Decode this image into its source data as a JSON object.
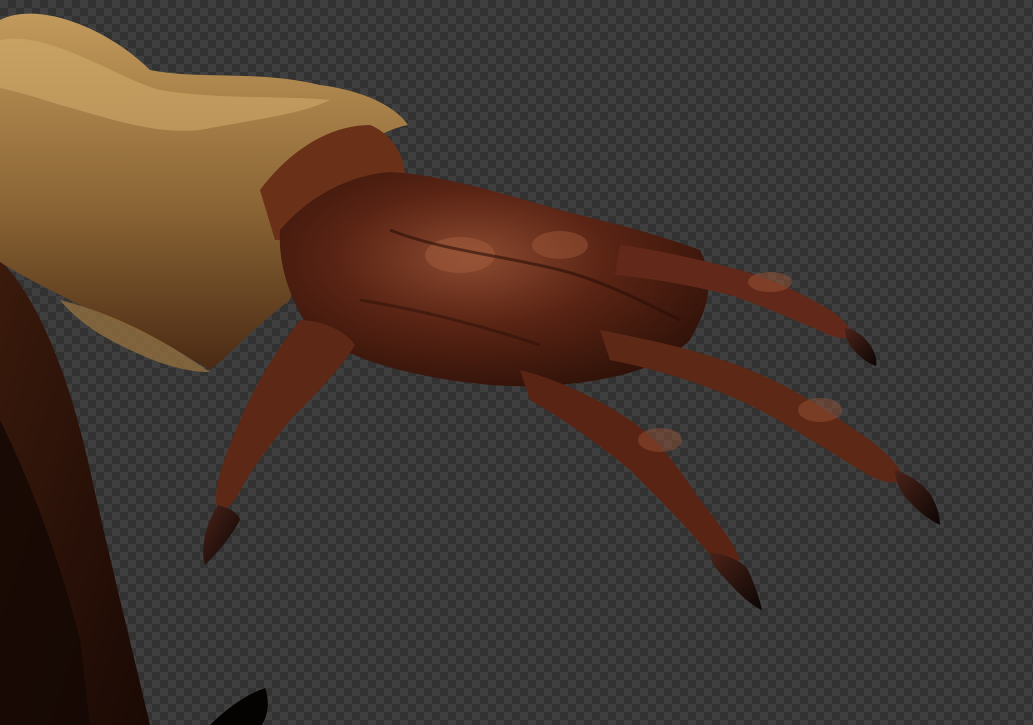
{
  "viewport": {
    "background": "transparency-checkerboard",
    "checker_colors": [
      "#3f3f3f",
      "#323232"
    ]
  },
  "render": {
    "subject": "creature-hand",
    "colors": {
      "skin_dark": "#2a0f07",
      "skin_mid": "#5a2414",
      "skin_light": "#8c4a30",
      "fur_light": "#b48a4e",
      "fur_dark": "#3a1a0c",
      "claw": "#120a08"
    }
  }
}
